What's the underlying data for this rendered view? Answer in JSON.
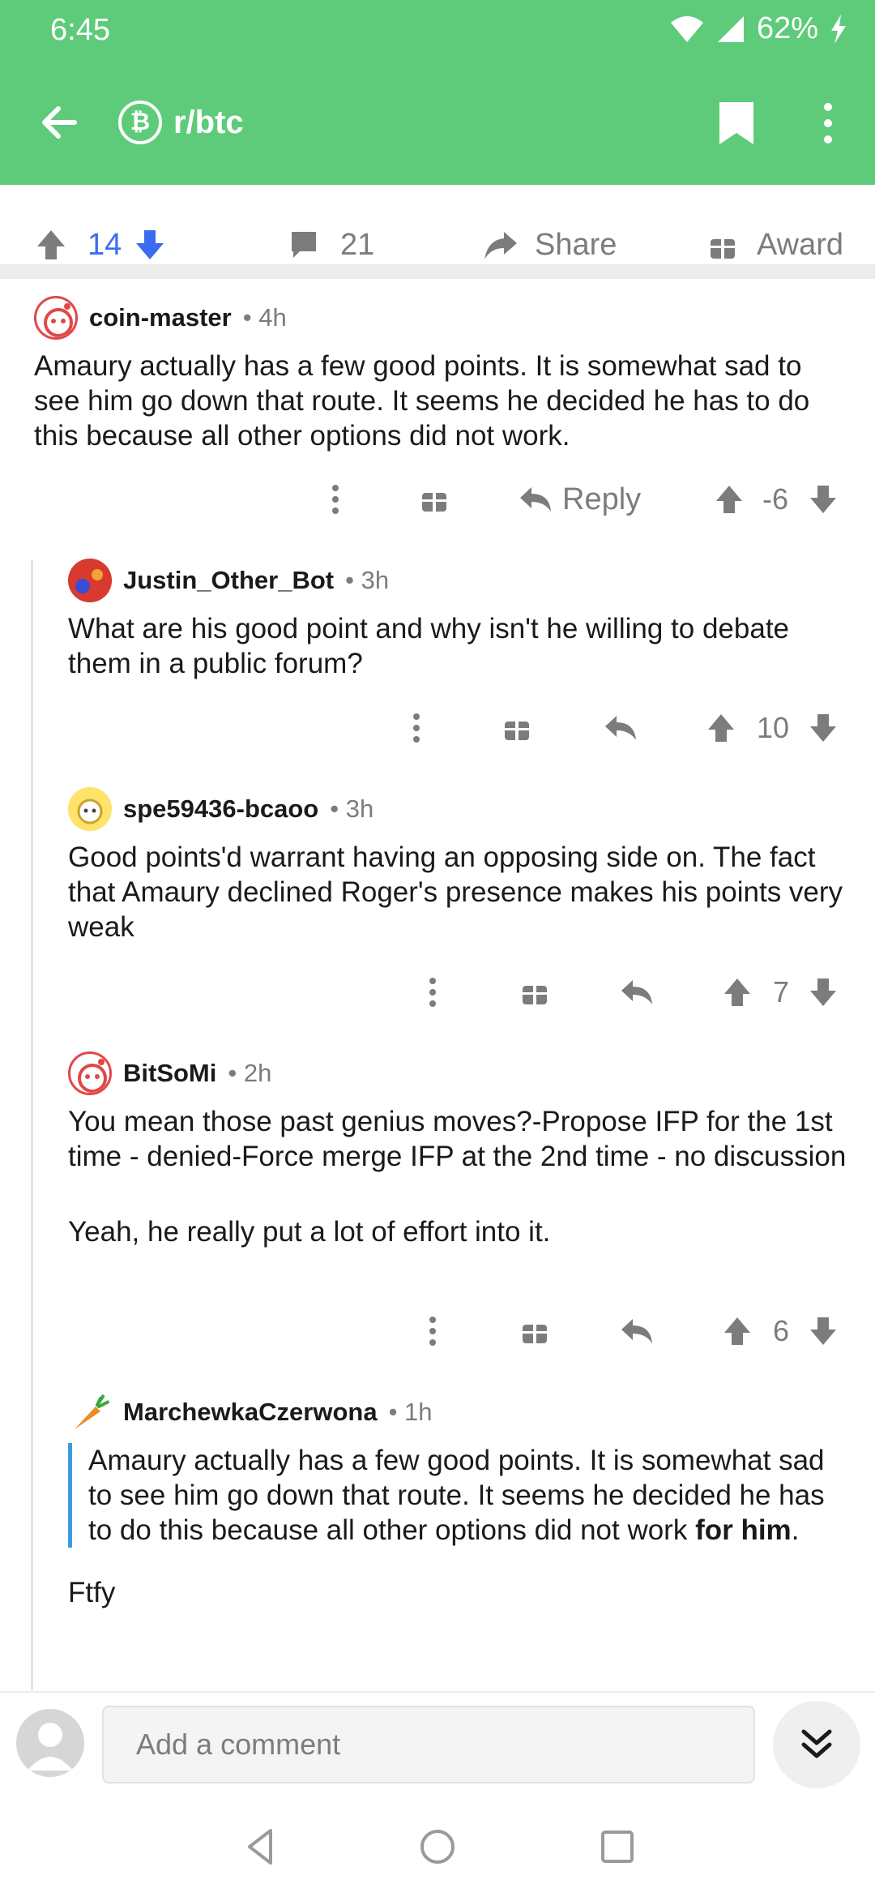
{
  "status_bar": {
    "time": "6:45",
    "battery": "62%"
  },
  "app_bar": {
    "subreddit": "r/btc",
    "sub_icon_glyph": "₿"
  },
  "post_actions": {
    "score": "14",
    "comments": "21",
    "share": "Share",
    "award": "Award"
  },
  "comments": [
    {
      "author": "coin-master",
      "age": "4h",
      "body": [
        "Amaury actually has a few good points. It is somewhat sad to see him go down that route. It seems he decided he has to do this because all other options did not work."
      ],
      "reply_label": "Reply",
      "score": "-6"
    },
    {
      "author": "Justin_Other_Bot",
      "age": "3h",
      "body": [
        "What are his good point and why isn't he willing to debate them in a public forum?"
      ],
      "score": "10"
    },
    {
      "author": "spe59436-bcaoo",
      "age": "3h",
      "body": [
        "Good points'd warrant having an opposing side on. The fact that Amaury declined Roger's presence makes his points very weak"
      ],
      "score": "7"
    },
    {
      "author": "BitSoMi",
      "age": "2h",
      "body": [
        "You mean those past genius moves?-Propose IFP for the 1st time - denied-Force merge IFP at the 2nd time - no discussion",
        "Yeah, he really put a lot of effort into it."
      ],
      "score": "6"
    },
    {
      "author": "MarchewkaCzerwona",
      "age": "1h",
      "quote": "Amaury actually has a few good points. It is somewhat sad to see him go down that route. It seems he decided he has to do this because all other options did not work",
      "quote_bold": "for him",
      "quote_end": ".",
      "body": [
        "Ftfy"
      ]
    }
  ],
  "composer": {
    "placeholder": "Add a comment"
  },
  "meta_sep": "•",
  "colors": {
    "appbar": "#5ecb7a",
    "upvote_active": "#3b6cf0",
    "quote_bar": "#3b9be0"
  }
}
